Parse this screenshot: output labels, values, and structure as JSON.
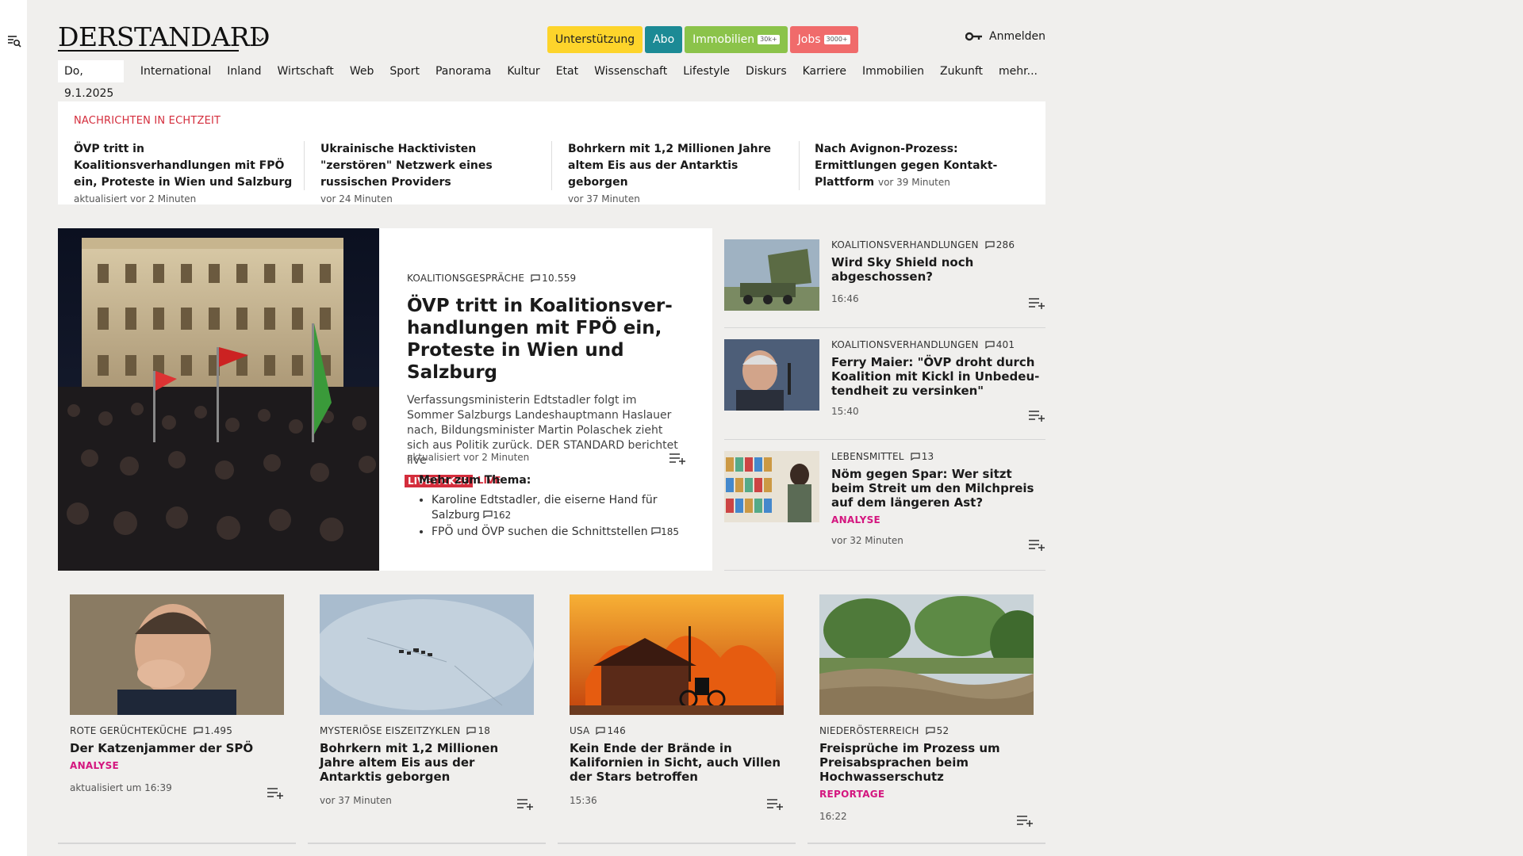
{
  "header": {
    "logo_text": "DERSTANDARD",
    "pills": [
      {
        "label": "Unterstützung",
        "tag": ""
      },
      {
        "label": "Abo",
        "tag": ""
      },
      {
        "label": "Immobilien",
        "tag": "30k+"
      },
      {
        "label": "Jobs",
        "tag": "3000+"
      }
    ],
    "login_label": "Anmelden"
  },
  "nav": {
    "date": "Do, 9.1.2025",
    "items": [
      "International",
      "Inland",
      "Wirtschaft",
      "Web",
      "Sport",
      "Panorama",
      "Kultur",
      "Etat",
      "Wissenschaft",
      "Lifestyle",
      "Diskurs",
      "Karriere",
      "Immobilien",
      "Zukunft",
      "mehr..."
    ]
  },
  "realtime": {
    "heading": "NACHRICHTEN IN ECHTZEIT",
    "items": [
      {
        "title": "ÖVP tritt in Koalitionsverhandlungen mit FPÖ ein, Proteste in Wien und Salzburg",
        "meta": "aktualisiert vor 2 Minuten"
      },
      {
        "title": "Ukrainische Hacktivisten \"zerstören\" Netzwerk eines russischen Providers",
        "meta": "vor 24 Minuten"
      },
      {
        "title": "Bohrkern mit 1,2 Millionen Jahre al­tem Eis aus der Antarktis geborgen",
        "meta": "vor 37 Minuten"
      },
      {
        "title": "Nach Avignon-Prozess: Ermittlungen gegen Kontakt-Plattform",
        "meta": "vor 39 Minuten"
      }
    ]
  },
  "lead": {
    "kicker": "KOALITIONSGESPRÄCHE",
    "comments": "10.559",
    "title": "ÖVP tritt in Koalitionsver­handlungen mit FPÖ ein, Proteste in Wien und Salzburg",
    "text": "Verfassungsministerin Edtstadler folgt im Sommer Salzburgs Landeshauptmann Haslauer nach, Bil­dungsminister Martin Polaschek zieht sich aus Politik zurück. DER STANDARD berichtet live",
    "badge": "LIVETICKER",
    "live": "LIVE",
    "meta": "aktualisiert vor 2 Minuten",
    "more_heading": "Mehr zum Thema:",
    "more_items": [
      {
        "text": "Karoline Edtstadler, die eiserne Hand für Salzburg",
        "comments": "162"
      },
      {
        "text": "FPÖ und ÖVP suchen die Schnittstellen",
        "comments": "185"
      }
    ]
  },
  "side": [
    {
      "kicker": "KOALITIONSVERHANDLUNGEN",
      "comments": "286",
      "title": "Wird Sky Shield noch abgeschossen?",
      "label": "",
      "meta": "16:46"
    },
    {
      "kicker": "KOALITIONSVERHANDLUNGEN",
      "comments": "401",
      "title": "Ferry Maier: \"ÖVP droht durch Koalition mit Kickl in Unbedeu­tendheit zu versinken\"",
      "label": "",
      "meta": "15:40"
    },
    {
      "kicker": "LEBENSMITTEL",
      "comments": "13",
      "title": "Nöm gegen Spar: Wer sitzt beim Streit um den Milchpreis auf dem längeren Ast?",
      "label": "ANALYSE",
      "meta": "vor 32 Minuten"
    }
  ],
  "cards": [
    {
      "kicker": "ROTE GERÜCHTEKÜCHE",
      "comments": "1.495",
      "title": "Der Katzenjammer der SPÖ",
      "label": "ANALYSE",
      "meta": "aktualisiert um 16:39"
    },
    {
      "kicker": "MYSTERIÖSE EISZEITZYKLEN",
      "comments": "18",
      "title": "Bohrkern mit 1,2 Millionen Jahre altem Eis aus der Antarktis geborgen",
      "label": "",
      "meta": "vor 37 Minuten"
    },
    {
      "kicker": "USA",
      "comments": "146",
      "title": "Kein Ende der Brände in Kalifornien in Sicht, auch Villen der Stars betroffen",
      "label": "",
      "meta": "15:36"
    },
    {
      "kicker": "NIEDERÖSTERREICH",
      "comments": "52",
      "title": "Freisprüche im Prozess um Preis­absprachen beim Hochwasser­schutz",
      "label": "REPORTAGE",
      "meta": "16:22"
    }
  ],
  "colors": {
    "accent_red": "#d42d3c",
    "label_pink": "#d4167f",
    "pill_yellow": "#fdd42b",
    "pill_teal": "#1c8a95",
    "pill_green": "#8bc34a",
    "pill_red": "#f06b6b"
  }
}
